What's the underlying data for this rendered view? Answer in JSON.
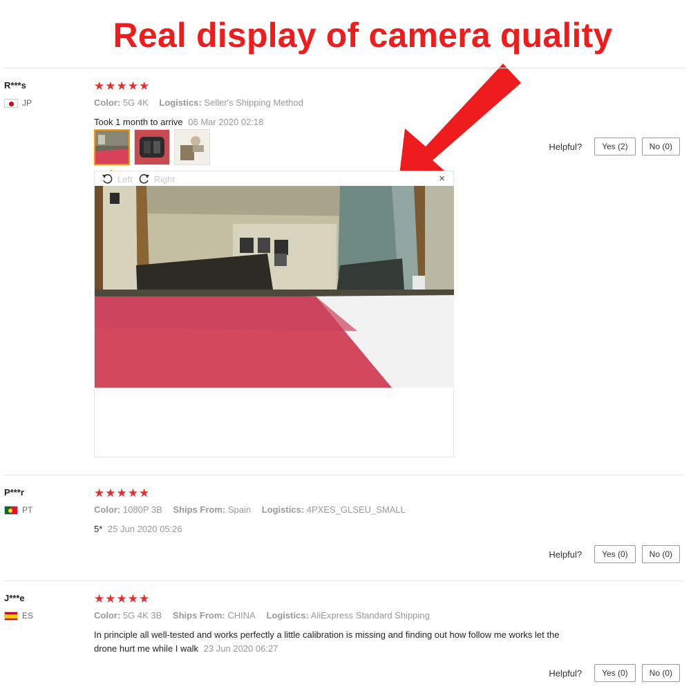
{
  "banner": {
    "text": "Real display of camera quality",
    "color": "#ee1c1c"
  },
  "reviews": [
    {
      "user": "R***s",
      "country": "JP",
      "stars": "★★★★★",
      "rating": 5,
      "attrs": [
        {
          "label": "Color:",
          "value": "5G 4K"
        },
        {
          "label": "Logistics:",
          "value": "Seller's Shipping Method"
        }
      ],
      "feedback": "Took 1 month to arrive",
      "date": "06 Mar 2020 02:18",
      "helpful_label": "Helpful?",
      "yes": "Yes (2)",
      "no": "No (0)",
      "viewer": {
        "left_label": "Left",
        "right_label": "Right",
        "close": "×"
      }
    },
    {
      "user": "P***r",
      "country": "PT",
      "stars": "★★★★★",
      "rating": 5,
      "attrs": [
        {
          "label": "Color:",
          "value": "1080P 3B"
        },
        {
          "label": "Ships From:",
          "value": "Spain"
        },
        {
          "label": "Logistics:",
          "value": "4PXES_GLSEU_SMALL"
        }
      ],
      "feedback": "5*",
      "date": "25 Jun 2020 05:26",
      "helpful_label": "Helpful?",
      "yes": "Yes (0)",
      "no": "No (0)"
    },
    {
      "user": "J***e",
      "country": "ES",
      "stars": "★★★★★",
      "rating": 5,
      "attrs": [
        {
          "label": "Color:",
          "value": "5G 4K 3B"
        },
        {
          "label": "Ships From:",
          "value": "CHINA"
        },
        {
          "label": "Logistics:",
          "value": "AliExpress Standard Shipping"
        }
      ],
      "feedback_line1": "In principle all well-tested and works perfectly a little calibration is missing and finding out how follow me works let the",
      "feedback_line2": "drone hurt me while I walk",
      "date": "23 Jun 2020 06:27",
      "helpful_label": "Helpful?",
      "yes": "Yes (0)",
      "no": "No (0)"
    }
  ]
}
